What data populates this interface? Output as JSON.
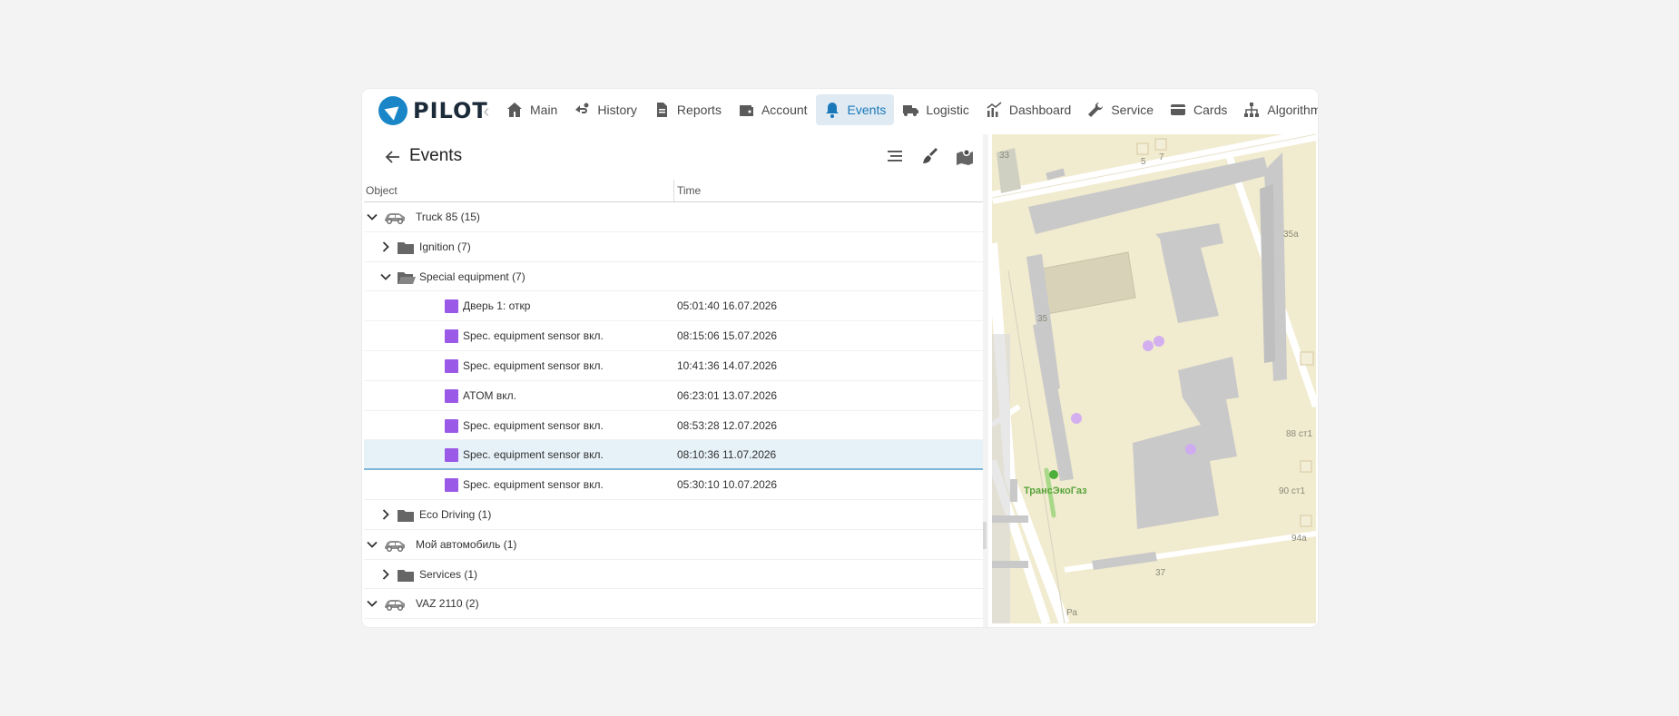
{
  "brand": {
    "name": "PILOT"
  },
  "nav": [
    {
      "label": "Main",
      "icon": "home-icon"
    },
    {
      "label": "History",
      "icon": "route-icon"
    },
    {
      "label": "Reports",
      "icon": "document-icon"
    },
    {
      "label": "Account",
      "icon": "wallet-icon"
    },
    {
      "label": "Events",
      "icon": "bell-icon",
      "active": true
    },
    {
      "label": "Logistic",
      "icon": "truck-icon"
    },
    {
      "label": "Dashboard",
      "icon": "chart-icon"
    },
    {
      "label": "Service",
      "icon": "wrench-icon"
    },
    {
      "label": "Cards",
      "icon": "card-icon"
    },
    {
      "label": "Algorithms",
      "icon": "hierarchy-icon"
    }
  ],
  "panel": {
    "title": "Events",
    "columns": {
      "object": "Object",
      "time": "Time"
    }
  },
  "rows": [
    {
      "kind": "vehicle",
      "expanded": true,
      "label": "Truck 85 (15)"
    },
    {
      "kind": "folder",
      "expanded": false,
      "label": "Ignition (7)"
    },
    {
      "kind": "folder",
      "expanded": true,
      "label": "Special equipment (7)"
    },
    {
      "kind": "event",
      "label": "Дверь 1: откр",
      "time": "05:01:40 16.07.2026"
    },
    {
      "kind": "event",
      "label": "Spec. equipment sensor вкл.",
      "time": "08:15:06 15.07.2026"
    },
    {
      "kind": "event",
      "label": "Spec. equipment sensor вкл.",
      "time": "10:41:36 14.07.2026"
    },
    {
      "kind": "event",
      "label": "ATOM вкл.",
      "time": "06:23:01 13.07.2026"
    },
    {
      "kind": "event",
      "label": "Spec. equipment sensor вкл.",
      "time": "08:53:28 12.07.2026"
    },
    {
      "kind": "event",
      "label": "Spec. equipment sensor вкл.",
      "time": "08:10:36 11.07.2026",
      "selected": true
    },
    {
      "kind": "event",
      "label": "Spec. equipment sensor вкл.",
      "time": "05:30:10 10.07.2026"
    },
    {
      "kind": "folder",
      "expanded": false,
      "label": "Eco Driving (1)"
    },
    {
      "kind": "vehicle",
      "expanded": true,
      "label": "Мой автомобиль (1)"
    },
    {
      "kind": "folder",
      "expanded": false,
      "label": "Services (1)"
    },
    {
      "kind": "vehicle",
      "expanded": true,
      "label": "VAZ 2110 (2)"
    }
  ],
  "map": {
    "labels": [
      "33",
      "5",
      "7",
      "35а",
      "35",
      "88 ст1",
      "90 ст1",
      "94а",
      "37",
      "Ра"
    ],
    "poi": "ТрансЭкоГаз"
  },
  "colors": {
    "accent": "#1a78b8",
    "event_marker": "#9b59e8",
    "selected_row": "#e6f1f8"
  }
}
